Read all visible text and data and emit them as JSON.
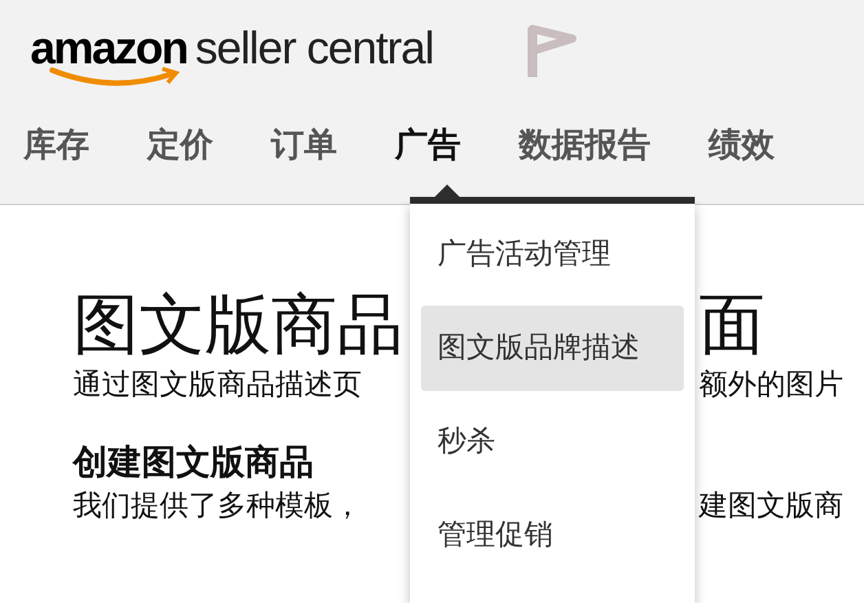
{
  "header": {
    "logo": {
      "brand": "amazon",
      "product": "seller central"
    }
  },
  "nav": [
    {
      "label": "库存",
      "selected": false
    },
    {
      "label": "定价",
      "selected": false
    },
    {
      "label": "订单",
      "selected": false
    },
    {
      "label": "广告",
      "selected": true
    },
    {
      "label": "数据报告",
      "selected": false
    },
    {
      "label": "绩效",
      "selected": false
    }
  ],
  "dropdown": [
    {
      "label": "广告活动管理",
      "selected": false
    },
    {
      "label": "图文版品牌描述",
      "selected": true
    },
    {
      "label": "秒杀",
      "selected": false
    },
    {
      "label": "管理促销",
      "selected": false
    }
  ],
  "content": [
    {
      "kind": "title",
      "left": "图文版商品",
      "right": "面"
    },
    {
      "kind": "text",
      "left": "通过图文版商品描述页",
      "right": "额外的图片"
    },
    {
      "kind": "subtitle",
      "left": "创建图文版商品"
    },
    {
      "kind": "text",
      "left": "我们提供了多种模板，",
      "right": "建图文版商"
    }
  ]
}
